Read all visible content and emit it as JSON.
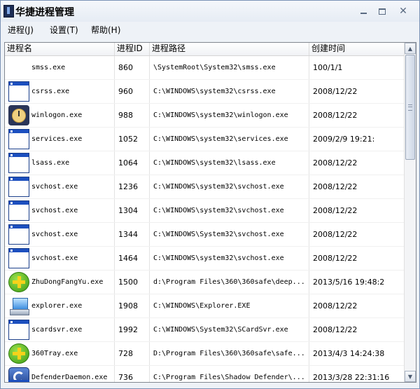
{
  "window": {
    "title": "华捷进程管理"
  },
  "menu": {
    "items": [
      {
        "label": "进程(J)"
      },
      {
        "label": "设置(T)"
      },
      {
        "label": "帮助(H)"
      }
    ]
  },
  "table": {
    "columns": [
      "进程名",
      "进程ID",
      "进程路径",
      "创建时间"
    ],
    "rows": [
      {
        "icon": "blank-icon",
        "name": "smss.exe",
        "pid": "860",
        "path": "\\SystemRoot\\System32\\smss.exe",
        "time": "100/1/1"
      },
      {
        "icon": "window-icon",
        "name": "csrss.exe",
        "pid": "960",
        "path": "C:\\WINDOWS\\system32\\csrss.exe",
        "time": "2008/12/22"
      },
      {
        "icon": "clock-icon",
        "name": "winlogon.exe",
        "pid": "988",
        "path": "C:\\WINDOWS\\system32\\winlogon.exe",
        "time": "2008/12/22"
      },
      {
        "icon": "window-icon",
        "name": "services.exe",
        "pid": "1052",
        "path": "C:\\WINDOWS\\system32\\services.exe",
        "time": "2009/2/9 19:21:"
      },
      {
        "icon": "window-icon",
        "name": "lsass.exe",
        "pid": "1064",
        "path": "C:\\WINDOWS\\system32\\lsass.exe",
        "time": "2008/12/22"
      },
      {
        "icon": "window-icon",
        "name": "svchost.exe",
        "pid": "1236",
        "path": "C:\\WINDOWS\\system32\\svchost.exe",
        "time": "2008/12/22"
      },
      {
        "icon": "window-icon",
        "name": "svchost.exe",
        "pid": "1304",
        "path": "C:\\WINDOWS\\system32\\svchost.exe",
        "time": "2008/12/22"
      },
      {
        "icon": "window-icon",
        "name": "svchost.exe",
        "pid": "1344",
        "path": "C:\\WINDOWS\\System32\\svchost.exe",
        "time": "2008/12/22"
      },
      {
        "icon": "window-icon",
        "name": "svchost.exe",
        "pid": "1464",
        "path": "C:\\WINDOWS\\system32\\svchost.exe",
        "time": "2008/12/22"
      },
      {
        "icon": "plus-icon",
        "name": "ZhuDongFangYu.exe",
        "pid": "1500",
        "path": "d:\\Program Files\\360\\360safe\\deep...",
        "time": "2013/5/16 19:48:2"
      },
      {
        "icon": "explorer-icon",
        "name": "explorer.exe",
        "pid": "1908",
        "path": "C:\\WINDOWS\\Explorer.EXE",
        "time": "2008/12/22"
      },
      {
        "icon": "window-icon",
        "name": "scardsvr.exe",
        "pid": "1992",
        "path": "C:\\WINDOWS\\System32\\SCardSvr.exe",
        "time": "2008/12/22"
      },
      {
        "icon": "plus-icon",
        "name": "360Tray.exe",
        "pid": "728",
        "path": "D:\\Program Files\\360\\360safe\\safe...",
        "time": "2013/4/3 14:24:38"
      },
      {
        "icon": "shield-icon",
        "name": "DefenderDaemon.exe",
        "pid": "736",
        "path": "C:\\Program Files\\Shadow Defender\\...",
        "time": "2013/3/28 22:31:16"
      }
    ]
  }
}
